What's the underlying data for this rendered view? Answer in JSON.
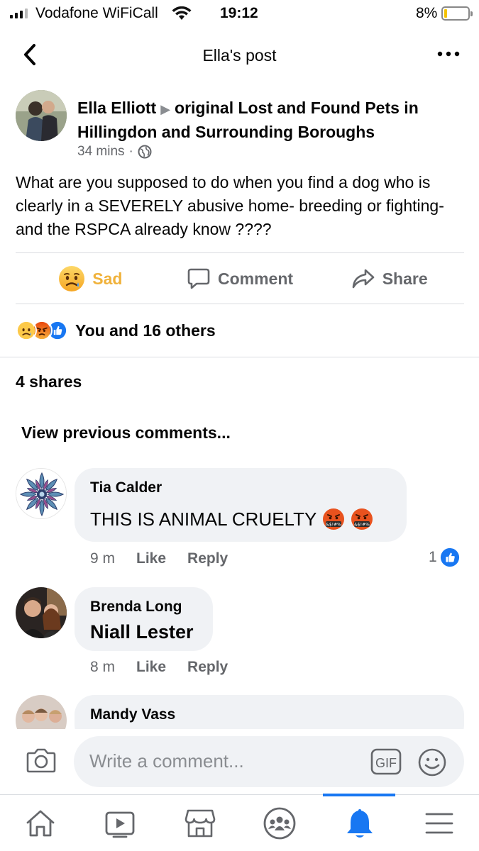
{
  "status_bar": {
    "carrier": "Vodafone WiFiCall",
    "time": "19:12",
    "battery": "8%",
    "battery_level": 0.08
  },
  "header": {
    "title": "Ella's post"
  },
  "post": {
    "author": "Ella Elliott",
    "group": "original Lost and Found Pets in Hillingdon and Surrounding Boroughs",
    "time": "34 mins",
    "dot": "·",
    "text": "What are you supposed to do when you find a dog who is clearly in a SEVERELY abusive home- breeding or fighting- and the RSPCA already know ????"
  },
  "actions": {
    "reaction": "Sad",
    "comment": "Comment",
    "share": "Share"
  },
  "reactions_summary": "You and 16 others",
  "shares": "4 shares",
  "view_previous": "View previous comments...",
  "comments": [
    {
      "name": "Tia Calder",
      "text": "THIS IS ANIMAL CRUELTY",
      "time": "9 m",
      "like": "Like",
      "reply": "Reply",
      "like_count": "1"
    },
    {
      "name": "Brenda Long",
      "text": "Niall Lester",
      "time": "8 m",
      "like": "Like",
      "reply": "Reply"
    },
    {
      "name": "Mandy Vass"
    }
  ],
  "composer": {
    "placeholder": "Write a comment...",
    "gif": "GIF"
  },
  "bottom_nav": [
    "home-icon",
    "watch-icon",
    "marketplace-icon",
    "groups-icon",
    "notifications-icon",
    "menu-icon"
  ],
  "colors": {
    "accent": "#1877f2",
    "sad": "#f0b23b",
    "bubble": "#f0f2f5",
    "secondary_text": "#65676b"
  }
}
